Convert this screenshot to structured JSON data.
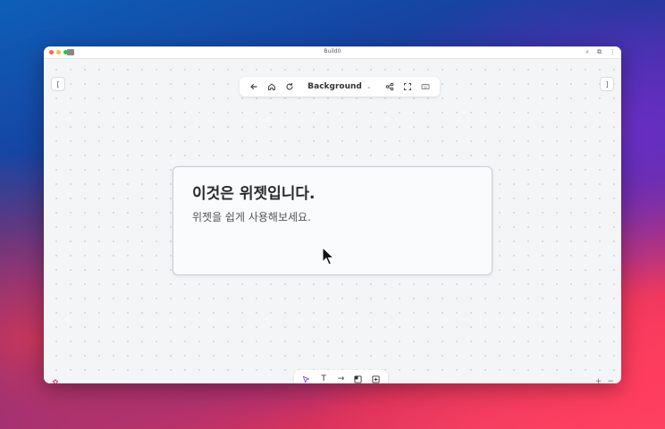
{
  "window": {
    "title": "Build0",
    "titlebar_icons": [
      "search-icon",
      "extension-icon",
      "more-icon"
    ]
  },
  "toolbar": {
    "background_label": "Background",
    "icons": [
      "back-arrow-icon",
      "home-icon",
      "refresh-icon",
      "share-icon",
      "fullscreen-icon",
      "keyboard-icon"
    ]
  },
  "side": {
    "left_label": "[",
    "right_label": "]"
  },
  "widget": {
    "title": "이것은 위젯입니다.",
    "body": "위젯을 쉽게 사용해보세요."
  },
  "bottom_toolbar": {
    "tools": [
      {
        "name": "select",
        "glyph": "➤",
        "active": true
      },
      {
        "name": "text",
        "glyph": "T",
        "active": false
      },
      {
        "name": "arrow",
        "glyph": "→",
        "active": false
      },
      {
        "name": "frame",
        "glyph": "◩",
        "active": false
      },
      {
        "name": "add",
        "glyph": "⊞",
        "active": false
      }
    ]
  },
  "zoom": {
    "plus": "+",
    "minus": "−"
  },
  "colors": {
    "accent": "#8a4dff",
    "app_icon": "#d4456a"
  }
}
